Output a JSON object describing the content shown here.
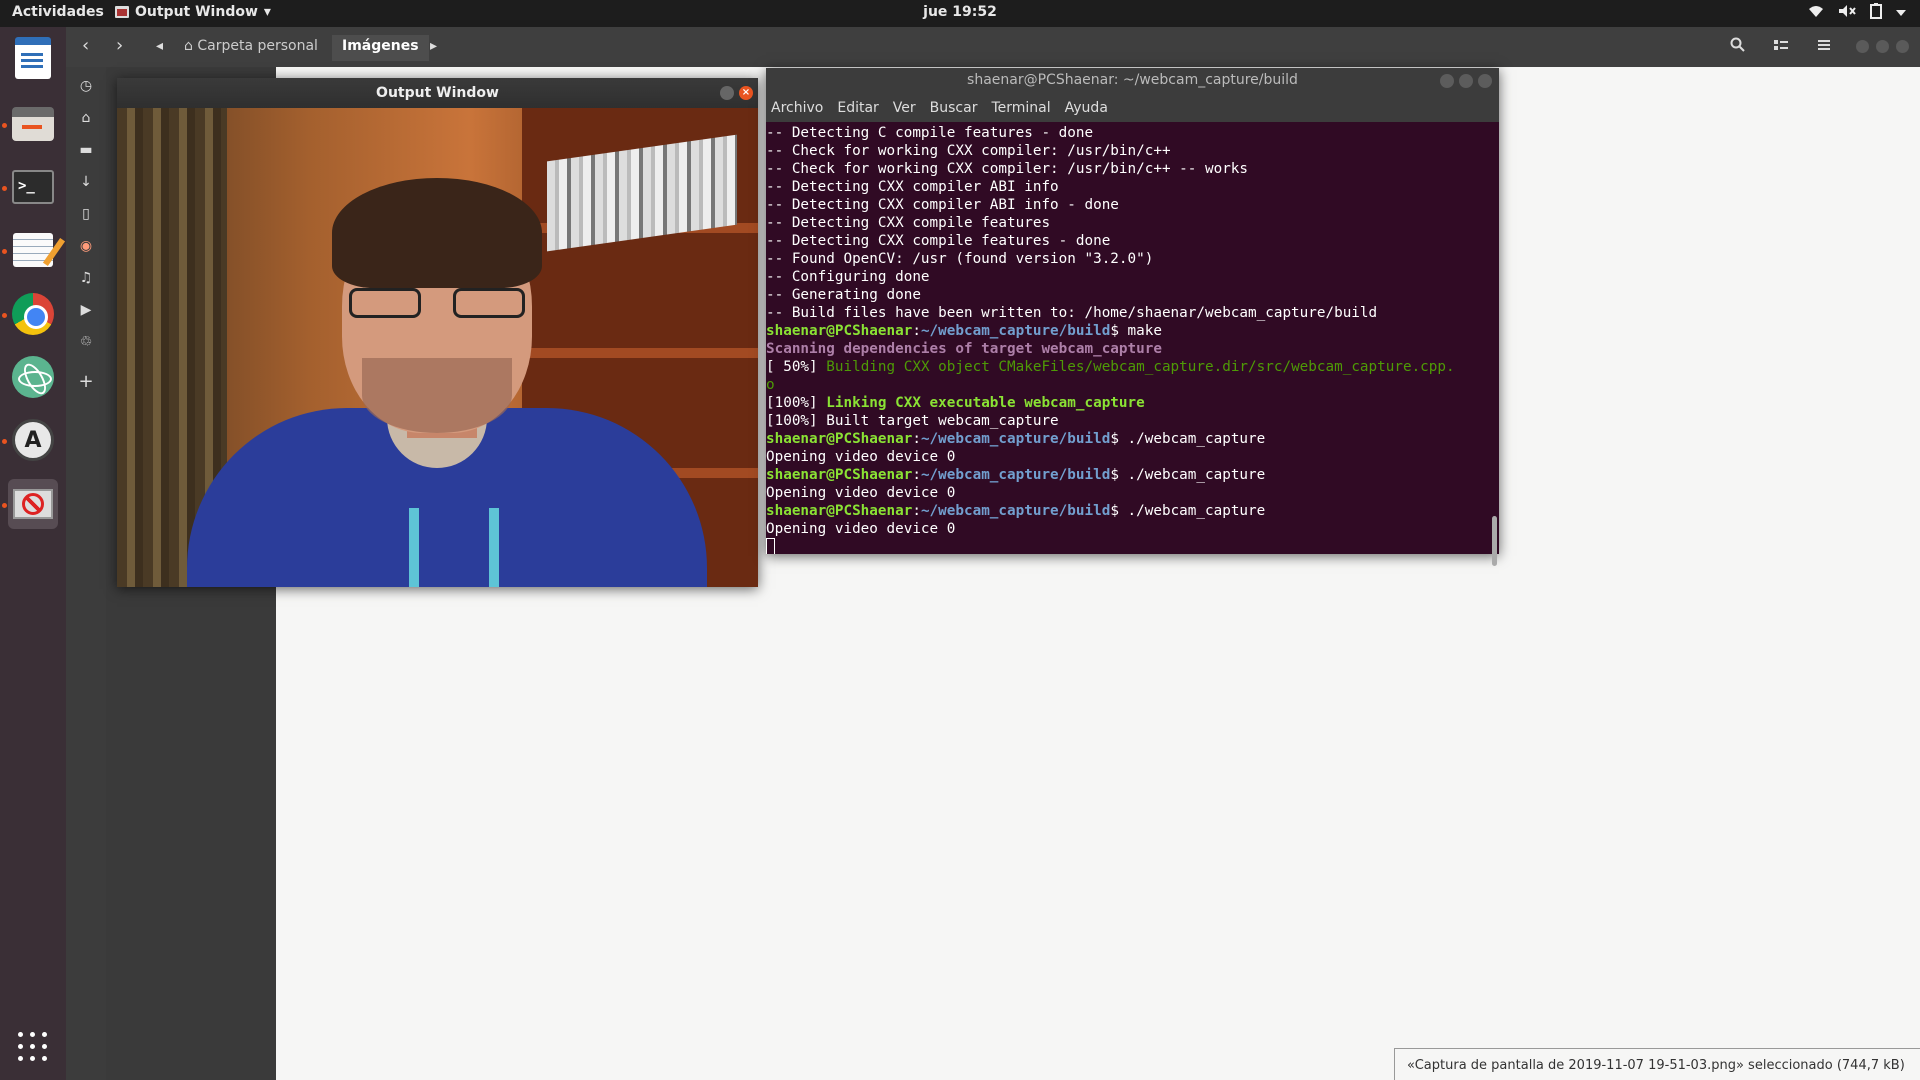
{
  "topbar": {
    "activities": "Actividades",
    "app_name": "Output Window",
    "app_caret": "▾",
    "clock": "jue 19:52",
    "icons": [
      "wifi-icon",
      "volume-muted-icon",
      "battery-icon",
      "system-menu-caret-icon"
    ]
  },
  "dock": {
    "items": [
      "writer-icon",
      "files-icon",
      "terminal-icon",
      "text-editor-icon",
      "chrome-icon",
      "atom-icon",
      "software-updater-icon",
      "output-window-icon"
    ],
    "terminal_glyph": ">_",
    "updater_glyph": "A"
  },
  "nautilus": {
    "breadcrumbs": [
      {
        "label": "Carpeta personal",
        "icon": "home-icon"
      },
      {
        "label": "Imágenes"
      }
    ],
    "status": "«Captura de pantalla de 2019-11-07 19-51-03.png» seleccionado (744,7 kB)"
  },
  "output_window": {
    "title": "Output Window",
    "close_glyph": "×"
  },
  "terminal": {
    "title": "shaenar@PCShaenar: ~/webcam_capture/build",
    "menu": [
      "Archivo",
      "Editar",
      "Ver",
      "Buscar",
      "Terminal",
      "Ayuda"
    ],
    "user_host": "shaenar@PCShaenar",
    "path": "~/webcam_capture/build",
    "lines": [
      "-- Detecting C compile features - done",
      "-- Check for working CXX compiler: /usr/bin/c++",
      "-- Check for working CXX compiler: /usr/bin/c++ -- works",
      "-- Detecting CXX compiler ABI info",
      "-- Detecting CXX compiler ABI info - done",
      "-- Detecting CXX compile features",
      "-- Detecting CXX compile features - done",
      "-- Found OpenCV: /usr (found version \"3.2.0\")",
      "-- Configuring done",
      "-- Generating done",
      "-- Build files have been written to: /home/shaenar/webcam_capture/build"
    ],
    "cmd_make": "make",
    "scan": "Scanning dependencies of target webcam_capture",
    "build50_prefix": "[ 50%]",
    "build50_text": " Building CXX object CMakeFiles/webcam_capture.dir/src/webcam_capture.cpp.",
    "build50_wrap": "o",
    "link_prefix": "[100%]",
    "link_text": " Linking CXX executable webcam_capture",
    "built": "[100%] Built target webcam_capture",
    "cmd_run": "./webcam_capture",
    "opening": "Opening video device 0"
  }
}
